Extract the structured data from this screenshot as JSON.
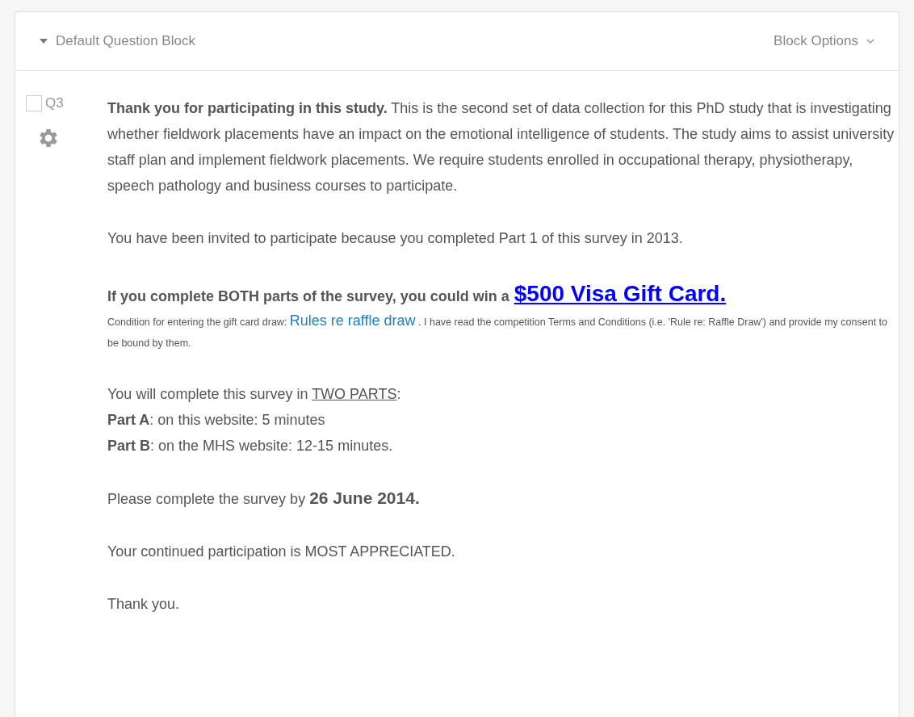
{
  "block": {
    "title": "Default Question Block",
    "options": "Block Options",
    "expanded": true
  },
  "question": {
    "label": "Q3",
    "checked": false
  },
  "intro": "**Thank you for participating in this study.** This is the second set of data collection for this PhD study that is investigating whether fieldwork placements have an impact on the emotional intelligence of students. The study aims to assist university staff plan and implement fieldwork placements. We require students enrolled in occupational therapy, physiotherapy, speech pathology and business courses to participate.",
  "invited": "You have been invited to participate because you completed Part 1 of this survey in 2013.",
  "prize": {
    "lead": "If you complete BOTH parts of the survey, you could win a",
    "link": "$500 Visa Gift Card."
  },
  "condition": {
    "lead": "Condition for entering the gift card draw:",
    "link": "Rules re raffle draw",
    "rest": ". I have read the competition Terms and Conditions (i.e. 'Rule re: Raffle Draw') and provide my consent to be bound by them."
  },
  "parts": {
    "lead": "You will complete this survey in",
    "emphasis": "TWO PARTS",
    "tail": ":",
    "lines": [
      "**Part A**: on this website: 5 minutes",
      "**Part B**: on the MHS website: 12-15 minutes."
    ]
  },
  "deadline": {
    "lead": "Please complete the survey by",
    "date": "26 June 2014."
  },
  "closing": [
    "Your continued participation is MOST APPRECIATED.",
    "Thank you."
  ]
}
